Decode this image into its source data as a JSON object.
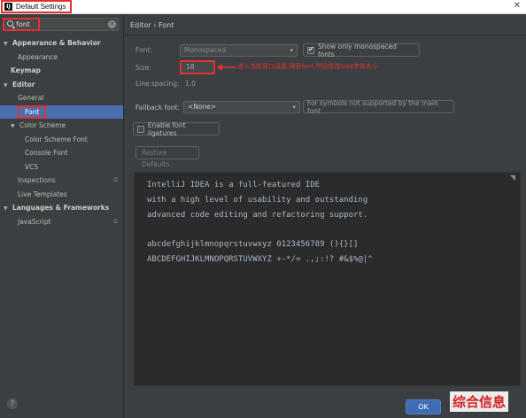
{
  "window": {
    "title": "Default Settings",
    "app_icon": "intellij-icon"
  },
  "search": {
    "value": "font"
  },
  "tree": [
    {
      "label": "Appearance & Behavior",
      "bold": true,
      "arrow": "▼",
      "indent": 0
    },
    {
      "label": "Appearance",
      "indent": 2
    },
    {
      "label": "Keymap",
      "bold": true,
      "indent": 1
    },
    {
      "label": "Editor",
      "bold": true,
      "arrow": "▼",
      "indent": 0
    },
    {
      "label": "General",
      "indent": 2
    },
    {
      "label": "Font",
      "selected": true,
      "highlight": true,
      "indent": 2
    },
    {
      "label": "Color Scheme",
      "arrow": "▼",
      "indent": 1
    },
    {
      "label": "Color Scheme Font",
      "indent": 3
    },
    {
      "label": "Console Font",
      "indent": 3
    },
    {
      "label": "VCS",
      "indent": 3
    },
    {
      "label": "Inspections",
      "indent": 2,
      "badge": "⧉"
    },
    {
      "label": "Live Templates",
      "indent": 2
    },
    {
      "label": "Languages & Frameworks",
      "bold": true,
      "arrow": "▼",
      "indent": 0
    },
    {
      "label": "JavaScript",
      "indent": 2,
      "badge": "⧉"
    }
  ],
  "breadcrumb": "Editor › Font",
  "form": {
    "font_label": "Font:",
    "font_value": "Monospaced",
    "show_monospaced_label": "Show only monospaced fonts",
    "size_label": "Size:",
    "size_value": "18",
    "line_spacing_label": "Line spacing:",
    "line_spacing_value": "1.0",
    "fallback_label": "Fallback font:",
    "fallback_value": "<None>",
    "fallback_hint": "For symbols not supported by the main font",
    "ligatures_label": "Enable font ligatures",
    "restore_label": "Restore Defaults"
  },
  "annotation": "进入当前窗口设置,搜索font,然后修改Size字体大小",
  "preview": [
    "IntelliJ IDEA is a full-featured IDE",
    "with a high level of usability and outstanding",
    "advanced code editing and refactoring support.",
    "",
    "abcdefghijklmnopqrstuvwxyz 0123456789 (){}[]",
    "ABCDEFGHIJKLMNOPQRSTUVWXYZ +-*/= .,;:!? #&$%@|^"
  ],
  "ok_label": "OK",
  "watermark": "综合信息",
  "accent_color": "#4b6eaf",
  "highlight_color": "#e53030"
}
